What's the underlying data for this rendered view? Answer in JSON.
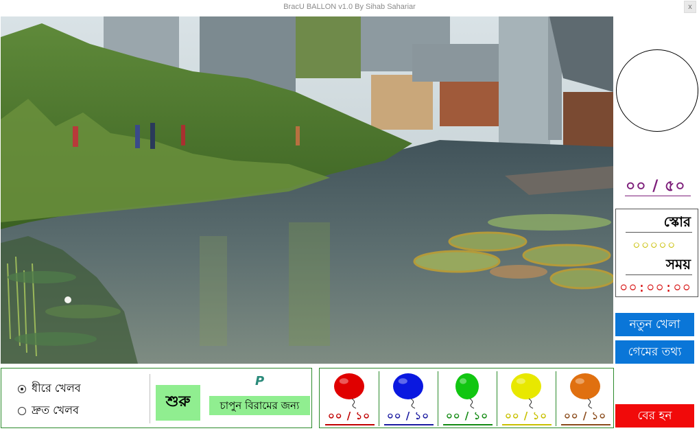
{
  "window": {
    "title": "BracU BALLON v1.0 By Sihab Sahariar",
    "close_label": "x"
  },
  "balloons_popped": "০০ / ৫০",
  "score": {
    "label": "স্কোর",
    "value": "০০০০০"
  },
  "time": {
    "label": "সময়",
    "value": "০০:০০:০০"
  },
  "buttons": {
    "new_game": "নতুন খেলা",
    "game_info": "গেমের তথ্য",
    "exit": "বের হন",
    "start": "শুরু"
  },
  "speed": {
    "slow": "ধীরে খেলব",
    "fast": "দ্রুত খেলব",
    "selected": "slow"
  },
  "pause": {
    "key": "P",
    "label": "চাপুন বিরামের জন্য"
  },
  "balloons": [
    {
      "color_name": "red",
      "color": "#e00000",
      "count": "০০ / ১০",
      "text_color": "#c00000"
    },
    {
      "color_name": "blue",
      "color": "#0a18e0",
      "count": "০০ / ১০",
      "text_color": "#1a1aa0"
    },
    {
      "color_name": "green",
      "color": "#11c611",
      "count": "০০ / ১০",
      "text_color": "#128a12"
    },
    {
      "color_name": "yellow",
      "color": "#e8e800",
      "count": "০০ / ১০",
      "text_color": "#c8c000"
    },
    {
      "color_name": "orange",
      "color": "#e07010",
      "count": "০০ / ১০",
      "text_color": "#8a4a1a"
    }
  ],
  "colors": {
    "accent_blue": "#0a76d8",
    "exit_red": "#f10a0a",
    "start_green": "#90ee90",
    "panel_border": "#2a8a2a"
  }
}
